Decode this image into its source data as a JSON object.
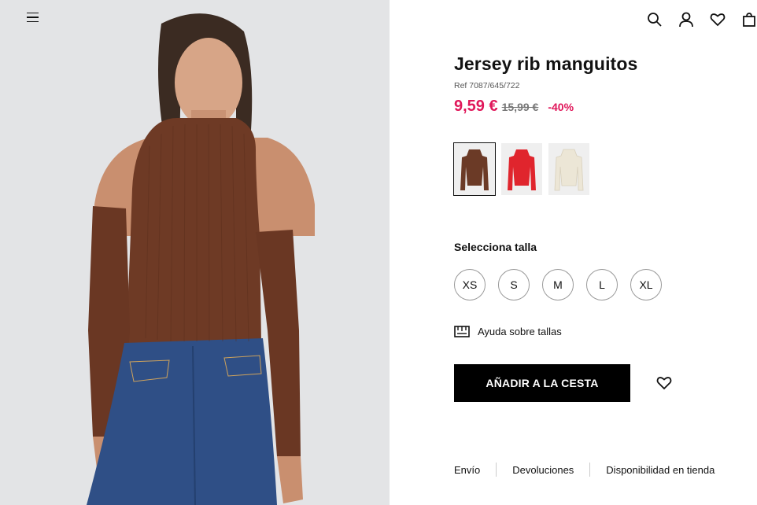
{
  "header": {
    "menu_icon": "hamburger-menu-icon",
    "icons": [
      "search-icon",
      "user-icon",
      "heart-icon",
      "shopping-bag-icon"
    ]
  },
  "product": {
    "title": "Jersey rib manguitos",
    "ref": "Ref 7087/645/722",
    "price": "9,59 €",
    "old_price": "15,99 €",
    "discount": "-40%",
    "colors": [
      {
        "name": "brown",
        "hex": "#6b3a26",
        "selected": true
      },
      {
        "name": "red",
        "hex": "#e0252d",
        "selected": false
      },
      {
        "name": "cream",
        "hex": "#ece6d6",
        "selected": false
      }
    ],
    "accent_color": "#e0175a"
  },
  "sizes": {
    "label": "Selecciona talla",
    "options": [
      "XS",
      "S",
      "M",
      "L",
      "XL"
    ]
  },
  "size_help": {
    "label": "Ayuda sobre tallas",
    "icon": "ruler-icon"
  },
  "actions": {
    "add_to_cart": "AÑADIR A LA CESTA",
    "wishlist_icon": "heart-outline-icon"
  },
  "info_tabs": [
    "Envío",
    "Devoluciones",
    "Disponibilidad en tienda"
  ]
}
